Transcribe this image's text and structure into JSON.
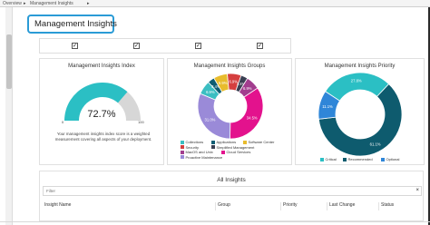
{
  "breadcrumb": {
    "items": [
      "Overview",
      "Management Insights"
    ]
  },
  "page": {
    "title": "Management Insights"
  },
  "filters": {
    "checkboxes": [
      {
        "checked": true,
        "mark": "✓"
      },
      {
        "checked": true,
        "mark": "✓"
      },
      {
        "checked": true,
        "mark": "✓"
      },
      {
        "checked": true,
        "mark": "✓"
      }
    ]
  },
  "index_card": {
    "title": "Management Insights Index",
    "value_label": "72.7%",
    "min": "0",
    "max": "100",
    "description": "Your management insights index score is a weighted measurement covering all aspects of your deployment."
  },
  "groups_card": {
    "title": "Management Insights Groups"
  },
  "priority_card": {
    "title": "Management Insights Priority"
  },
  "chart_data": [
    {
      "type": "gauge",
      "title": "Management Insights Index",
      "value": 72.7,
      "min": 0,
      "max": 100,
      "colors": {
        "value": "#2bbfc4",
        "track": "#d7d7d7"
      }
    },
    {
      "type": "pie",
      "title": "Management Insights Groups",
      "series": [
        {
          "name": "Collections",
          "value": 6.9,
          "color": "#3bbec2"
        },
        {
          "name": "Applications",
          "value": 3.4,
          "color": "#0f5d73"
        },
        {
          "name": "Software Center",
          "value": 6.9,
          "color": "#e8bc2d"
        },
        {
          "name": "Security",
          "value": 6.9,
          "color": "#d53f3f"
        },
        {
          "name": "Simplified Management",
          "value": 3.4,
          "color": "#3a3f52"
        },
        {
          "name": "MacOS and Unix",
          "value": 6.9,
          "color": "#a23d8e"
        },
        {
          "name": "Cloud Services",
          "value": 34.5,
          "color": "#e3128d"
        },
        {
          "name": "Proactive Maintenance",
          "value": 31.0,
          "color": "#9a8ad8"
        }
      ],
      "slice_labels": [
        "6.9%",
        "3.4%",
        "6.9%",
        "6.9%",
        "3.4%",
        "6.9%",
        "34.5%",
        "31.0%"
      ]
    },
    {
      "type": "pie",
      "title": "Management Insights Priority",
      "series": [
        {
          "name": "Critical",
          "value": 27.8,
          "color": "#2bbfc4"
        },
        {
          "name": "Recommended",
          "value": 61.1,
          "color": "#0e5b6e"
        },
        {
          "name": "Optional",
          "value": 11.1,
          "color": "#2f86d8"
        }
      ],
      "slice_labels": [
        "27.8%",
        "61.1%",
        "11.1%"
      ]
    }
  ],
  "all_insights": {
    "title": "All Insights",
    "filter_placeholder": "Filter",
    "clear_icon": "×",
    "columns": [
      "Insight Name",
      "Group",
      "Priority",
      "Last Change",
      "Status"
    ]
  }
}
